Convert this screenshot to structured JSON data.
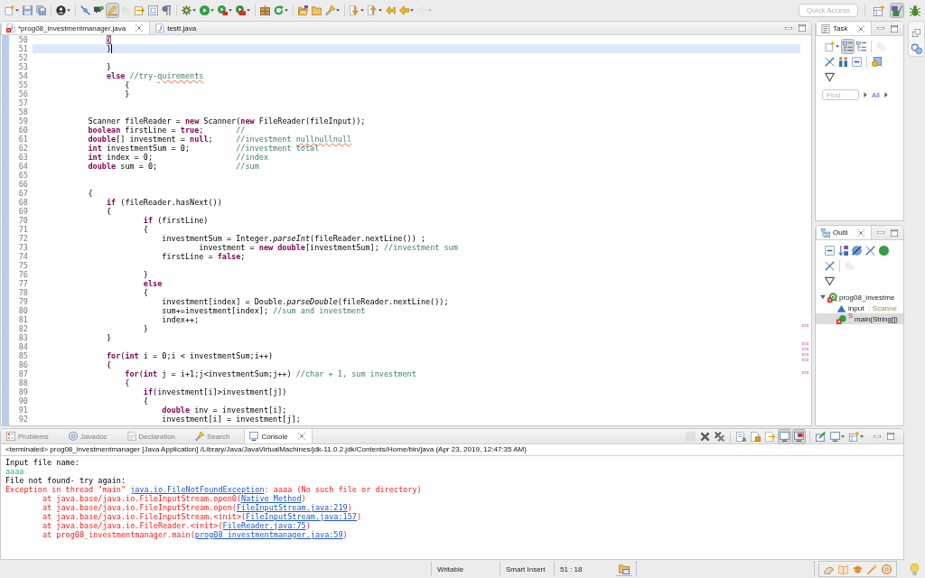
{
  "toolbar": {
    "buttons": [
      {
        "pressed": false,
        "disabled": false
      },
      {
        "pressed": false,
        "disabled": false
      },
      {
        "pressed": false,
        "disabled": false
      },
      {
        "pressed": false,
        "disabled": false
      },
      {
        "pressed": false,
        "disabled": false
      },
      {
        "pressed": false,
        "disabled": false
      },
      {
        "pressed": true,
        "disabled": false
      },
      {
        "pressed": false,
        "disabled": true
      },
      {
        "pressed": false,
        "disabled": false
      },
      {
        "pressed": false,
        "disabled": false
      },
      {
        "pressed": false,
        "disabled": false
      },
      {
        "pressed": false,
        "disabled": false
      },
      {
        "pressed": false,
        "disabled": false
      },
      {
        "pressed": false,
        "disabled": false
      },
      {
        "pressed": false,
        "disabled": false
      },
      {
        "pressed": false,
        "disabled": false
      },
      {
        "pressed": false,
        "disabled": false
      },
      {
        "pressed": false,
        "disabled": false
      },
      {
        "pressed": false,
        "disabled": false
      },
      {
        "pressed": false,
        "disabled": false
      },
      {
        "pressed": false,
        "disabled": false
      },
      {
        "pressed": false,
        "disabled": false
      },
      {
        "pressed": false,
        "disabled": false
      },
      {
        "pressed": false,
        "disabled": false
      },
      {
        "pressed": false,
        "disabled": true
      }
    ],
    "quick_access": {
      "placeholder": "Quick Access"
    },
    "perspectives": [
      {
        "selected": false
      },
      {
        "selected": true
      },
      {
        "selected": false
      }
    ]
  },
  "editor": {
    "tabs": [
      {
        "label": "*prog08_investmentmanager.java",
        "selected": true,
        "error": true
      },
      {
        "label": "testt.java",
        "selected": false,
        "error": false
      }
    ],
    "lines": [
      {
        "number": "50",
        "current": false,
        "segments": [
          {
            "kind": "bracket",
            "text": "\t\t\t\t{"
          }
        ]
      },
      {
        "number": "51",
        "current": true,
        "segments": [
          {
            "kind": "plain",
            "text": "\t\t\t\t}"
          }
        ]
      },
      {
        "number": "52",
        "current": false
      },
      {
        "number": "53",
        "current": false,
        "segments": [
          {
            "kind": "plain",
            "text": "\t\t\t\t}"
          }
        ]
      },
      {
        "number": "54",
        "current": false,
        "segments": [
          {
            "kind": "keyword",
            "text": "\t\t\t\telse"
          },
          {
            "kind": "comment",
            "text": " //try-"
          },
          {
            "kind": "misspelled",
            "text": "quirements"
          }
        ]
      },
      {
        "number": "55",
        "current": false,
        "segments": [
          {
            "kind": "plain",
            "text": "\t\t\t\t\t{"
          }
        ]
      },
      {
        "number": "56",
        "current": false,
        "segments": [
          {
            "kind": "plain",
            "text": "\t\t\t\t\t}"
          }
        ]
      },
      {
        "number": "57",
        "current": false
      },
      {
        "number": "58",
        "current": false
      },
      {
        "number": "59",
        "current": false,
        "segments": [
          {
            "kind": "plain",
            "text": "\t\t\tScanner fileReader = "
          },
          {
            "kind": "keyword",
            "text": "new"
          },
          {
            "kind": "plain",
            "text": " Scanner("
          },
          {
            "kind": "keyword",
            "text": "new"
          },
          {
            "kind": "plain",
            "text": " FileReader(fileInput));"
          }
        ]
      },
      {
        "number": "60",
        "current": false,
        "segments": [
          {
            "kind": "keyword",
            "text": "\t\t\tboolean"
          },
          {
            "kind": "plain",
            "text": " firstLine = "
          },
          {
            "kind": "keyword",
            "text": "true"
          },
          {
            "kind": "plain",
            "text": ";\t\t"
          },
          {
            "kind": "comment",
            "text": "//"
          }
        ]
      },
      {
        "number": "61",
        "current": false,
        "segments": [
          {
            "kind": "keyword",
            "text": "\t\t\tdouble"
          },
          {
            "kind": "plain",
            "text": "[] investment = "
          },
          {
            "kind": "keyword",
            "text": "null"
          },
          {
            "kind": "plain",
            "text": ";\t\t"
          },
          {
            "kind": "comment",
            "text": "//investment "
          },
          {
            "kind": "misspelled",
            "text": "nullnullnull"
          }
        ]
      },
      {
        "number": "62",
        "current": false,
        "segments": [
          {
            "kind": "keyword",
            "text": "\t\t\tint"
          },
          {
            "kind": "plain",
            "text": " investmentSum = 0;\t\t\t"
          },
          {
            "kind": "comment",
            "text": "//investment total"
          }
        ]
      },
      {
        "number": "63",
        "current": false,
        "segments": [
          {
            "kind": "keyword",
            "text": "\t\t\tint"
          },
          {
            "kind": "plain",
            "text": " index = 0;\t\t\t\t\t"
          },
          {
            "kind": "comment",
            "text": "//index"
          }
        ]
      },
      {
        "number": "64",
        "current": false,
        "segments": [
          {
            "kind": "keyword",
            "text": "\t\t\tdouble"
          },
          {
            "kind": "plain",
            "text": " sum = 0;\t\t\t\t\t"
          },
          {
            "kind": "comment",
            "text": "//sum"
          }
        ]
      },
      {
        "number": "65",
        "current": false
      },
      {
        "number": "66",
        "current": false
      },
      {
        "number": "67",
        "current": false,
        "segments": [
          {
            "kind": "plain",
            "text": "\t\t\t{"
          }
        ]
      },
      {
        "number": "68",
        "current": false,
        "segments": [
          {
            "kind": "keyword",
            "text": "\t\t\t\tif"
          },
          {
            "kind": "plain",
            "text": " (fileReader.hasNext())"
          }
        ]
      },
      {
        "number": "69",
        "current": false,
        "segments": [
          {
            "kind": "plain",
            "text": "\t\t\t\t{"
          }
        ]
      },
      {
        "number": "70",
        "current": false,
        "segments": [
          {
            "kind": "keyword",
            "text": "\t\t\t\t\t\tif"
          },
          {
            "kind": "plain",
            "text": " (firstLine)"
          }
        ]
      },
      {
        "number": "71",
        "current": false,
        "segments": [
          {
            "kind": "plain",
            "text": "\t\t\t\t\t\t{"
          }
        ]
      },
      {
        "number": "72",
        "current": false,
        "segments": [
          {
            "kind": "plain",
            "text": "\t\t\t\t\t\t\tinvestmentSum = Integer."
          },
          {
            "kind": "italic",
            "text": "parseInt"
          },
          {
            "kind": "plain",
            "text": "(fileReader.nextLine()) ;"
          }
        ]
      },
      {
        "number": "73",
        "current": false,
        "segments": [
          {
            "kind": "plain",
            "text": "\t\t\t\t\t\t\t\t\tinvestment = "
          },
          {
            "kind": "keyword",
            "text": "new double"
          },
          {
            "kind": "plain",
            "text": "[investmentSum]; "
          },
          {
            "kind": "comment",
            "text": "//investment sum"
          }
        ]
      },
      {
        "number": "74",
        "current": false,
        "segments": [
          {
            "kind": "plain",
            "text": "\t\t\t\t\t\t\tfirstLine = "
          },
          {
            "kind": "keyword",
            "text": "false"
          },
          {
            "kind": "plain",
            "text": ";"
          }
        ]
      },
      {
        "number": "75",
        "current": false
      },
      {
        "number": "76",
        "current": false,
        "segments": [
          {
            "kind": "plain",
            "text": "\t\t\t\t\t\t}"
          }
        ]
      },
      {
        "number": "77",
        "current": false,
        "segments": [
          {
            "kind": "keyword",
            "text": "\t\t\t\t\t\telse"
          }
        ]
      },
      {
        "number": "78",
        "current": false,
        "segments": [
          {
            "kind": "plain",
            "text": "\t\t\t\t\t\t{"
          }
        ]
      },
      {
        "number": "79",
        "current": false,
        "segments": [
          {
            "kind": "plain",
            "text": "\t\t\t\t\t\t\tinvestment[index] = Double."
          },
          {
            "kind": "italic",
            "text": "parseDouble"
          },
          {
            "kind": "plain",
            "text": "(fileReader.nextLine());"
          }
        ]
      },
      {
        "number": "80",
        "current": false,
        "segments": [
          {
            "kind": "plain",
            "text": "\t\t\t\t\t\t\tsum+=investment[index]; "
          },
          {
            "kind": "comment",
            "text": "//sum and investment"
          }
        ]
      },
      {
        "number": "81",
        "current": false,
        "segments": [
          {
            "kind": "plain",
            "text": "\t\t\t\t\t\t\tindex++;"
          }
        ]
      },
      {
        "number": "82",
        "current": false,
        "segments": [
          {
            "kind": "plain",
            "text": "\t\t\t\t\t\t}"
          }
        ]
      },
      {
        "number": "83",
        "current": false,
        "segments": [
          {
            "kind": "plain",
            "text": "\t\t\t\t}"
          }
        ]
      },
      {
        "number": "84",
        "current": false
      },
      {
        "number": "85",
        "current": false,
        "segments": [
          {
            "kind": "keyword",
            "text": "\t\t\t\tfor"
          },
          {
            "kind": "plain",
            "text": "("
          },
          {
            "kind": "keyword",
            "text": "int"
          },
          {
            "kind": "plain",
            "text": " i = 0;i < investmentSum;i++)"
          }
        ]
      },
      {
        "number": "86",
        "current": false,
        "segments": [
          {
            "kind": "plain",
            "text": "\t\t\t\t{"
          }
        ]
      },
      {
        "number": "87",
        "current": false,
        "segments": [
          {
            "kind": "keyword",
            "text": "\t\t\t\t\tfor"
          },
          {
            "kind": "plain",
            "text": "("
          },
          {
            "kind": "keyword",
            "text": "int"
          },
          {
            "kind": "plain",
            "text": " j = i+1;j<investmentSum;j++) "
          },
          {
            "kind": "comment",
            "text": "//char + 1, sum investment"
          }
        ]
      },
      {
        "number": "88",
        "current": false,
        "segments": [
          {
            "kind": "plain",
            "text": "\t\t\t\t\t{"
          }
        ]
      },
      {
        "number": "89",
        "current": false,
        "segments": [
          {
            "kind": "keyword",
            "text": "\t\t\t\t\t\tif"
          },
          {
            "kind": "plain",
            "text": "(investment[i]>investment[j])"
          }
        ]
      },
      {
        "number": "90",
        "current": false,
        "segments": [
          {
            "kind": "plain",
            "text": "\t\t\t\t\t\t{"
          }
        ]
      },
      {
        "number": "91",
        "current": false,
        "segments": [
          {
            "kind": "keyword",
            "text": "\t\t\t\t\t\t\tdouble"
          },
          {
            "kind": "plain",
            "text": " inv = investment[i];"
          }
        ]
      },
      {
        "number": "92",
        "current": false,
        "segments": [
          {
            "kind": "plain",
            "text": "\t\t\t\t\t\t\tinvestment[i] = investment[j];"
          }
        ]
      }
    ]
  },
  "task_view": {
    "tab": "Task",
    "buttons": [
      {
        "pressed": false,
        "disabled": false
      },
      {
        "pressed": true,
        "disabled": false
      },
      {
        "pressed": false,
        "disabled": false
      },
      {
        "pressed": false,
        "disabled": true
      },
      {
        "pressed": false,
        "disabled": false
      },
      {
        "pressed": false,
        "disabled": false
      },
      {
        "pressed": false,
        "disabled": false
      },
      {
        "pressed": false,
        "disabled": false
      },
      {
        "pressed": false,
        "disabled": false
      }
    ],
    "find": {
      "placeholder": "Find"
    },
    "filter": "All"
  },
  "outline_view": {
    "tab": "Outli",
    "buttons": [
      {
        "disabled": false
      },
      {
        "disabled": false
      },
      {
        "disabled": false
      },
      {
        "disabled": false
      },
      {
        "disabled": false
      },
      {
        "disabled": false
      },
      {
        "disabled": true
      },
      {
        "disabled": false
      }
    ],
    "tree": [
      {
        "kind": "class",
        "label": "prog08_investme",
        "error": true,
        "expanded": true,
        "selected": false,
        "children": [
          {
            "kind": "field",
            "label": "input",
            "type": ": Scanne",
            "error": false,
            "selected": false
          },
          {
            "kind": "method",
            "label": "main(String[])",
            "badge": "S",
            "error": true,
            "selected": true
          }
        ]
      }
    ]
  },
  "bottom_panel": {
    "tabs": [
      {
        "label": "Problems",
        "selected": false
      },
      {
        "label": "Javadoc",
        "selected": false
      },
      {
        "label": "Declaration",
        "selected": false
      },
      {
        "label": "Search",
        "selected": false
      },
      {
        "label": "Console",
        "selected": true
      }
    ],
    "buttons": [
      {
        "pressed": false,
        "disabled": true
      },
      {
        "pressed": false,
        "disabled": false
      },
      {
        "pressed": false,
        "disabled": false
      },
      {
        "pressed": false,
        "disabled": false
      },
      {
        "pressed": false,
        "disabled": false
      },
      {
        "pressed": false,
        "disabled": false
      },
      {
        "pressed": true,
        "disabled": false
      },
      {
        "pressed": true,
        "disabled": false
      },
      {
        "pressed": false,
        "disabled": false
      },
      {
        "pressed": false,
        "disabled": false
      },
      {
        "pressed": false,
        "disabled": false
      }
    ],
    "console": {
      "process": "<terminated> prog08_investmentmanager [Java Application] /Library/Java/JavaVirtualMachines/jdk-11.0.2.jdk/Contents/Home/bin/java (Apr 23, 2019, 12:47:35 AM)",
      "lines": [
        {
          "kind": "stdout",
          "segments": [
            {
              "kind": "text",
              "text": "Input file name:"
            }
          ]
        },
        {
          "kind": "stdin",
          "segments": [
            {
              "kind": "text",
              "text": "aaaa"
            }
          ]
        },
        {
          "kind": "stdout",
          "segments": [
            {
              "kind": "text",
              "text": "File not found- try again:"
            }
          ]
        },
        {
          "kind": "stderr",
          "segments": [
            {
              "kind": "text",
              "text": "Exception in thread \"main\" "
            },
            {
              "kind": "link",
              "text": "java.io.FileNotFoundException"
            },
            {
              "kind": "text",
              "text": ": aaaa (No such file or directory)"
            }
          ]
        },
        {
          "kind": "stderr",
          "segments": [
            {
              "kind": "text",
              "text": "\tat java.base/java.io.FileInputStream.open0("
            },
            {
              "kind": "link",
              "text": "Native Method"
            },
            {
              "kind": "text",
              "text": ")"
            }
          ]
        },
        {
          "kind": "stderr",
          "segments": [
            {
              "kind": "text",
              "text": "\tat java.base/java.io.FileInputStream.open("
            },
            {
              "kind": "link",
              "text": "FileInputStream.java:219"
            },
            {
              "kind": "text",
              "text": ")"
            }
          ]
        },
        {
          "kind": "stderr",
          "segments": [
            {
              "kind": "text",
              "text": "\tat java.base/java.io.FileInputStream.<init>("
            },
            {
              "kind": "link",
              "text": "FileInputStream.java:157"
            },
            {
              "kind": "text",
              "text": ")"
            }
          ]
        },
        {
          "kind": "stderr",
          "segments": [
            {
              "kind": "text",
              "text": "\tat java.base/java.io.FileReader.<init>("
            },
            {
              "kind": "link",
              "text": "FileReader.java:75"
            },
            {
              "kind": "text",
              "text": ")"
            }
          ]
        },
        {
          "kind": "stderr",
          "segments": [
            {
              "kind": "text",
              "text": "\tat prog08_investmentmanager.main("
            },
            {
              "kind": "link",
              "text": "prog08_investmentmanager.java:59"
            },
            {
              "kind": "text",
              "text": ")"
            }
          ]
        }
      ]
    }
  },
  "status_bar": {
    "fields": [
      "Writable",
      "Smart Insert",
      "51 : 18"
    ]
  }
}
